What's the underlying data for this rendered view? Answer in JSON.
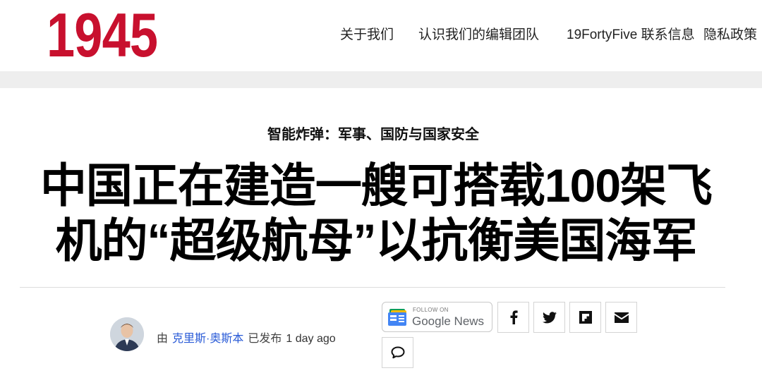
{
  "header": {
    "logo": "1945",
    "nav": [
      {
        "label": "关于我们"
      },
      {
        "label": "认识我们的编辑团队"
      },
      {
        "label": "19FortyFive 联系信息"
      },
      {
        "label": "隐私政策"
      }
    ]
  },
  "article": {
    "category": "智能炸弹：军事、国防与国家安全",
    "headline": "中国正在建造一艘可搭载100架飞机的“超级航母”以抗衡美国海军",
    "byline": {
      "prefix": "由",
      "author": "克里斯·奥斯本",
      "published_label": "已发布",
      "time": "1 day ago"
    }
  },
  "share": {
    "google_news": {
      "follow_label": "FOLLOW ON",
      "brand": "Google News"
    },
    "buttons": [
      {
        "icon": "facebook-icon"
      },
      {
        "icon": "twitter-icon"
      },
      {
        "icon": "flipboard-icon"
      },
      {
        "icon": "email-icon"
      },
      {
        "icon": "comment-icon"
      }
    ]
  },
  "colors": {
    "logo": "#c8102e",
    "author_link": "#2a5bd7",
    "grey_band": "#eeeeee"
  }
}
